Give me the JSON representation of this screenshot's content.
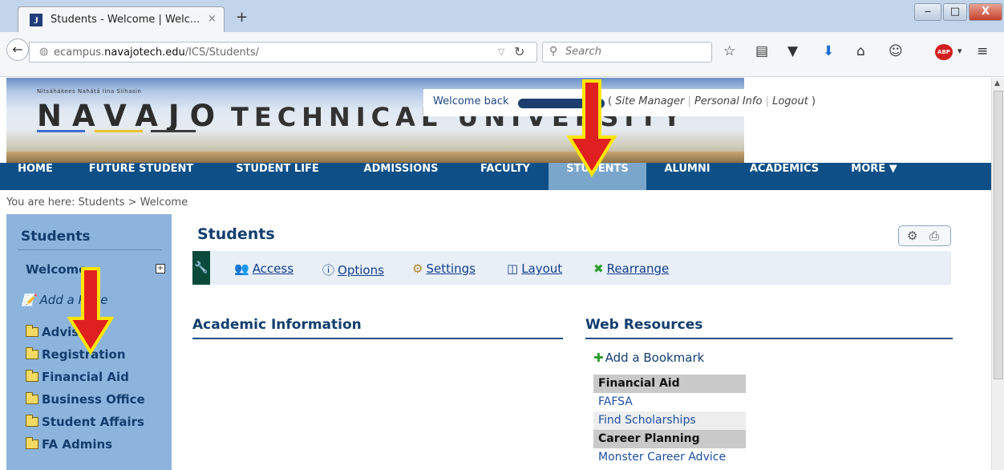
{
  "browser": {
    "tab_title": "Students - Welcome | Welc...",
    "tab_close": "×",
    "new_tab": "+",
    "url_prefix": "ecampus.",
    "url_domain": "navajotech.edu",
    "url_path": "/ICS/Students/",
    "search_placeholder": "Search",
    "win_minimize": "‒",
    "win_maximize": "□",
    "win_close": "X"
  },
  "banner": {
    "tagline": "Nitsáhákees Nahátá Iina Siihasin",
    "logo_text": "NAVAJO",
    "logo_text2": "TECHNICAL UNIVERSITY"
  },
  "welcome": {
    "text": "Welcome back",
    "links": [
      "Site Manager",
      "Personal Info",
      "Logout"
    ]
  },
  "nav": {
    "items": [
      "HOME",
      "FUTURE STUDENT",
      "STUDENT LIFE",
      "ADMISSIONS",
      "FACULTY",
      "STUDENTS",
      "ALUMNI",
      "ACADEMICS",
      "MORE ▼"
    ],
    "active": "STUDENTS"
  },
  "breadcrumb": "You are here:  Students > Welcome",
  "sidebar": {
    "heading": "Students",
    "welcome": "Welcome",
    "expand": "+",
    "add_page": "Add a Page",
    "items": [
      "Advising",
      "Registration",
      "Financial Aid",
      "Business Office",
      "Student Affairs",
      "FA Admins"
    ]
  },
  "main": {
    "title": "Students",
    "toolbar": [
      "Access",
      "Options",
      "Settings",
      "Layout",
      "Rearrange"
    ],
    "col_left_title": "Academic Information",
    "col_right_title": "Web Resources",
    "add_bookmark": "Add a Bookmark",
    "web_resources": [
      {
        "text": "Financial Aid",
        "kind": "header"
      },
      {
        "text": "FAFSA",
        "kind": "link"
      },
      {
        "text": "Find Scholarships",
        "kind": "link"
      },
      {
        "text": "Career Planning",
        "kind": "header"
      },
      {
        "text": "Monster Career Advice",
        "kind": "link"
      }
    ]
  },
  "colors": {
    "nav_bar": "#0d4f86",
    "nav_active": "#7aa6cc",
    "sidebar": "#8db4dc",
    "arrow_fill": "#e02020",
    "arrow_outline": "#ffe600"
  }
}
